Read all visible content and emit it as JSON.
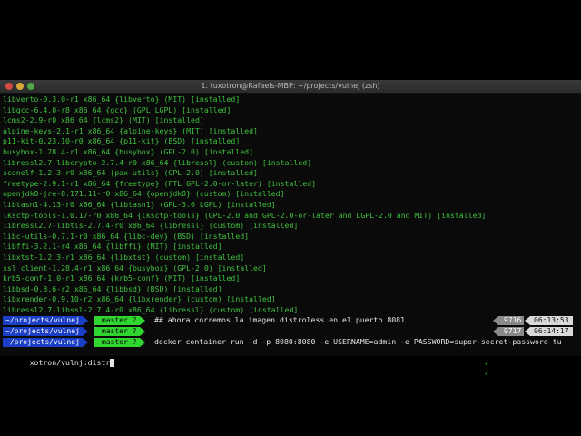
{
  "window": {
    "title": "1. tuxotron@Rafaels-MBP: ~/projects/vulnej (zsh)"
  },
  "output_lines": [
    "libverto-0.3.0-r1 x86_64 {libverto} (MIT) [installed]",
    "libgcc-6.4.0-r8 x86_64 {gcc} (GPL LGPL) [installed]",
    "lcms2-2.9-r0 x86_64 {lcms2} (MIT) [installed]",
    "alpine-keys-2.1-r1 x86_64 {alpine-keys} (MIT) [installed]",
    "p11-kit-0.23.10-r0 x86_64 {p11-kit} (BSD) [installed]",
    "busybox-1.28.4-r1 x86_64 {busybox} (GPL-2.0) [installed]",
    "libressl2.7-libcrypto-2.7.4-r0 x86_64 {libressl} (custom) [installed]",
    "scanelf-1.2.3-r0 x86_64 {pax-utils} (GPL-2.0) [installed]",
    "freetype-2.9.1-r1 x86_64 {freetype} (FTL GPL-2.0-or-later) [installed]",
    "openjdk8-jre-8.171.11-r0 x86_64 {openjdk8} (custom) [installed]",
    "libtasn1-4.13-r0 x86_64 {libtasn1} (GPL-3.0 LGPL) [installed]",
    "lksctp-tools-1.0.17-r0 x86_64 {lksctp-tools} (GPL-2.0 and GPL-2.0-or-later and LGPL-2.0 and MIT) [installed]",
    "libressl2.7-libtls-2.7.4-r0 x86_64 {libressl} (custom) [installed]",
    "libc-utils-0.7.1-r0 x86_64 {libc-dev} (BSD) [installed]",
    "libffi-3.2.1-r4 x86_64 {libffi} (MIT) [installed]",
    "libxtst-1.2.3-r1 x86_64 {libxtst} (custom) [installed]",
    "ssl_client-1.28.4-r1 x86_64 {busybox} (GPL-2.0) [installed]",
    "krb5-conf-1.0-r1 x86_64 {krb5-conf} (MIT) [installed]",
    "libbsd-0.8.6-r2 x86_64 {libbsd} (BSD) [installed]",
    "libxrender-0.9.10-r2 x86_64 {libxrender} (custom) [installed]",
    "libressl2.7-libssl-2.7.4-r0 x86_64 {libressl} (custom) [installed]"
  ],
  "prompts": [
    {
      "cwd": "~/projects/vulnej",
      "branch": "master ?",
      "command": "## ahora corremos la imagen distroless en el puerto 8081",
      "check": "✓",
      "history": "9716",
      "time": "06:13:53"
    },
    {
      "cwd": "~/projects/vulnej",
      "branch": "master ?",
      "command": "",
      "check": "✓",
      "history": "9717",
      "time": "06:14:17"
    },
    {
      "cwd": "~/projects/vulnej",
      "branch": "master ?",
      "command": "docker container run -d -p 8080:8080 -e USERNAME=admin -e PASSWORD=super-secret-password tu",
      "check": "",
      "history": "",
      "time": ""
    }
  ],
  "continuation_line": "xotron/vulnj:distr",
  "colors": {
    "output_text": "#3fc13f",
    "cwd_segment": "#1a3fc6",
    "git_segment": "#2fd62f",
    "history_segment": "#8a8a8a",
    "time_segment": "#d9d9d9"
  }
}
